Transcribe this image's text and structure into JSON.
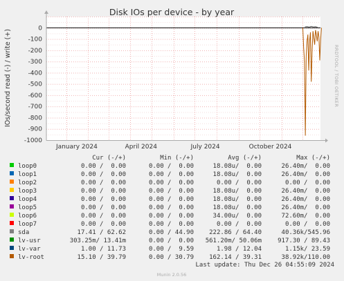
{
  "chart_data": {
    "type": "line",
    "title": "Disk IOs per device - by year",
    "ylabel": "IOs/second read (-) / write (+)",
    "side_label": "RRDTOOL / TOBI OETIKER",
    "ylim": [
      -1000,
      100
    ],
    "yticks": [
      0,
      -100,
      -200,
      -300,
      -400,
      -500,
      -600,
      -700,
      -800,
      -900,
      -1000
    ],
    "xticks": [
      "January 2024",
      "April 2024",
      "July 2024",
      "October 2024"
    ],
    "x_range": [
      "2023-12-04",
      "2024-12-26"
    ],
    "spikes": {
      "series": "lv-root",
      "start": "2024-12-01",
      "read_values": [
        -180,
        -300,
        -960,
        -250,
        -120,
        -60,
        -380,
        -120,
        -40,
        -480,
        -200,
        -30,
        -90,
        -150,
        -20,
        -60,
        -120,
        -30,
        -80,
        -290,
        -110
      ],
      "write_values": [
        8,
        10,
        6,
        12,
        7,
        9,
        5
      ]
    },
    "series": [
      {
        "name": "loop0",
        "color": "#00cc00",
        "cur": "0.00 /  0.00",
        "min": "0.00 /  0.00",
        "avg": "18.08u/  0.00",
        "max": "26.40m/  0.00"
      },
      {
        "name": "loop1",
        "color": "#0066b3",
        "cur": "0.00 /  0.00",
        "min": "0.00 /  0.00",
        "avg": "18.08u/  0.00",
        "max": "26.40m/  0.00"
      },
      {
        "name": "loop2",
        "color": "#ff8000",
        "cur": "0.00 /  0.00",
        "min": "0.00 /  0.00",
        "avg": "0.00 /  0.00",
        "max": "0.00 /  0.00"
      },
      {
        "name": "loop3",
        "color": "#ffcc00",
        "cur": "0.00 /  0.00",
        "min": "0.00 /  0.00",
        "avg": "18.08u/  0.00",
        "max": "26.40m/  0.00"
      },
      {
        "name": "loop4",
        "color": "#330099",
        "cur": "0.00 /  0.00",
        "min": "0.00 /  0.00",
        "avg": "18.08u/  0.00",
        "max": "26.40m/  0.00"
      },
      {
        "name": "loop5",
        "color": "#990099",
        "cur": "0.00 /  0.00",
        "min": "0.00 /  0.00",
        "avg": "18.08u/  0.00",
        "max": "26.40m/  0.00"
      },
      {
        "name": "loop6",
        "color": "#ccff00",
        "cur": "0.00 /  0.00",
        "min": "0.00 /  0.00",
        "avg": "34.00u/  0.00",
        "max": "72.60m/  0.00"
      },
      {
        "name": "loop7",
        "color": "#ff0000",
        "cur": "0.00 /  0.00",
        "min": "0.00 /  0.00",
        "avg": "0.00 /  0.00",
        "max": "0.00 /  0.00"
      },
      {
        "name": "sda",
        "color": "#808080",
        "cur": "17.41 / 62.62",
        "min": "0.00 / 44.90",
        "avg": "222.86 / 64.40",
        "max": "40.36k/545.96"
      },
      {
        "name": "lv-usr",
        "color": "#008f00",
        "cur": "303.25m/ 13.41m",
        "min": "0.00 /  0.00",
        "avg": "561.20m/ 50.06m",
        "max": "917.30 / 89.43"
      },
      {
        "name": "lv-var",
        "color": "#00487d",
        "cur": "1.00 / 11.73",
        "min": "0.00 /  9.59",
        "avg": "1.98 / 12.04",
        "max": "1.15k/ 23.59"
      },
      {
        "name": "lv-root",
        "color": "#b35a00",
        "cur": "15.10 / 39.79",
        "min": "0.00 / 30.79",
        "avg": "162.14 / 39.31",
        "max": "38.92k/110.00"
      }
    ],
    "columns": [
      "Cur (-/+)",
      "Min (-/+)",
      "Avg (-/+)",
      "Max (-/+)"
    ],
    "last_update": "Last update: Thu Dec 26 04:55:09 2024",
    "footer": "Munin 2.0.56"
  }
}
